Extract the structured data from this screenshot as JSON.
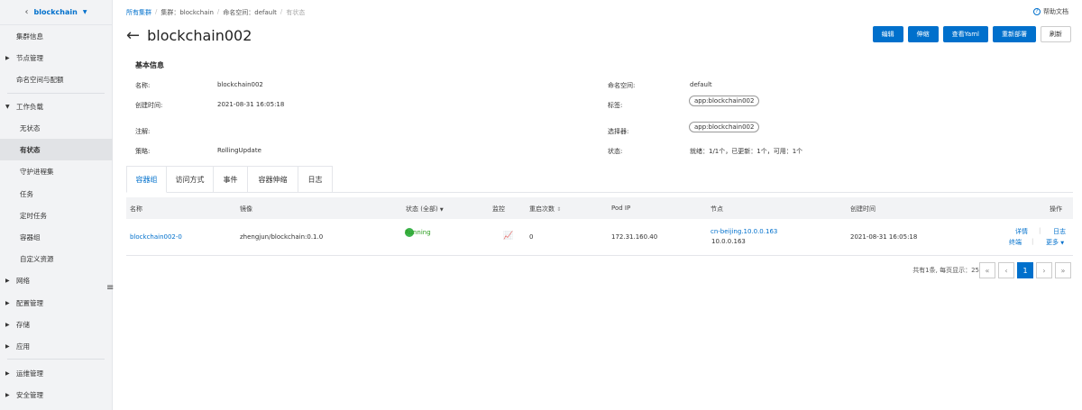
{
  "sidebar": {
    "cluster_name": "blockchain",
    "items": [
      {
        "label": "集群信息"
      },
      {
        "label": "节点管理"
      },
      {
        "label": "命名空间与配额"
      },
      {
        "label": "工作负载"
      },
      {
        "label": "无状态"
      },
      {
        "label": "有状态"
      },
      {
        "label": "守护进程集"
      },
      {
        "label": "任务"
      },
      {
        "label": "定时任务"
      },
      {
        "label": "容器组"
      },
      {
        "label": "自定义资源"
      },
      {
        "label": "网络"
      },
      {
        "label": "配置管理"
      },
      {
        "label": "存储"
      },
      {
        "label": "应用"
      },
      {
        "label": "运维管理"
      },
      {
        "label": "安全管理"
      }
    ]
  },
  "breadcrumb": {
    "all_clusters": "所有集群",
    "cluster": "集群：blockchain",
    "namespace": "命名空间：default",
    "current": "有状态"
  },
  "help_label": "帮助文档",
  "page_title": "blockchain002",
  "actions": {
    "edit": "编辑",
    "scale": "伸缩",
    "view_yaml": "查看Yaml",
    "redeploy": "重新部署",
    "refresh": "刷新"
  },
  "basic_info": {
    "title": "基本信息",
    "name_label": "名称:",
    "name_value": "blockchain002",
    "created_label": "创建时间:",
    "created_value": "2021-08-31 16:05:18",
    "annotation_label": "注解:",
    "strategy_label": "策略:",
    "strategy_value": "RollingUpdate",
    "namespace_label": "命名空间:",
    "namespace_value": "default",
    "labels_label": "标签:",
    "labels_value": "app:blockchain002",
    "selector_label": "选择器:",
    "selector_value": "app:blockchain002",
    "status_label": "状态:",
    "status_value": "就绪：1/1个，已更新：1个，可用：1个"
  },
  "tabs": [
    "容器组",
    "访问方式",
    "事件",
    "容器伸缩",
    "日志"
  ],
  "table": {
    "headers": {
      "name": "名称",
      "image": "镜像",
      "status": "状态 (全部)",
      "monitor": "监控",
      "restarts": "重启次数",
      "pod_ip": "Pod IP",
      "node": "节点",
      "created": "创建时间",
      "ops": "操作"
    },
    "rows": [
      {
        "name": "blockchain002-0",
        "image": "zhengjun/blockchain:0.1.0",
        "status": "Running",
        "restarts": "0",
        "pod_ip": "172.31.160.40",
        "node_name": "cn-beijing.10.0.0.163",
        "node_ip": "10.0.0.163",
        "created": "2021-08-31 16:05:18",
        "op_detail": "详情",
        "op_log": "日志",
        "op_terminal": "终端",
        "op_more": "更多"
      }
    ]
  },
  "pagination": {
    "summary": "共有1条, 每页显示：25条",
    "current_page": "1"
  },
  "colors": {
    "primary": "#0070cc",
    "running": "#3bb34a"
  }
}
